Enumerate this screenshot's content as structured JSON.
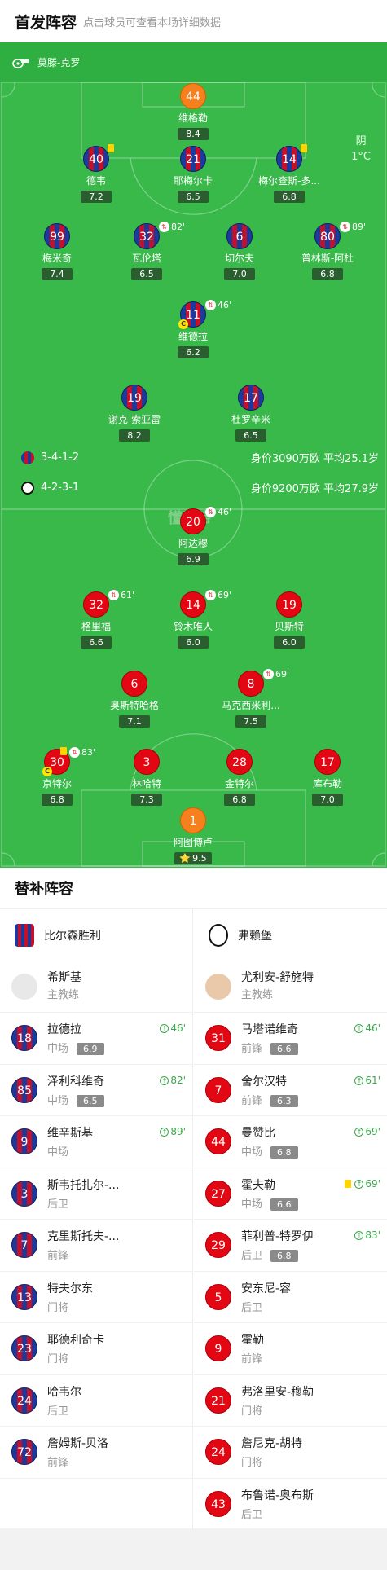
{
  "header": {
    "title": "首发阵容",
    "subtitle": "点击球员可查看本场详细数据"
  },
  "pitch": {
    "referee": "莫滕-克罗",
    "weather": {
      "condition": "阴",
      "temp": "1°C"
    },
    "watermark": "懂球帝",
    "home_formation": "3-4-1-2",
    "home_info": "身价3090万欧 平均25.1岁",
    "away_formation": "4-2-3-1",
    "away_info": "身价9200万欧 平均27.9岁",
    "colors": {
      "grass": "#38b94a",
      "home_blue": "#1d3a9a",
      "home_red": "#c4102b",
      "away_red": "#e30613",
      "gk_orange": "#f6801d"
    }
  },
  "home_players": [
    {
      "num": "44",
      "name": "维格勒",
      "rating": "8.4",
      "kind": "gk"
    },
    {
      "num": "40",
      "name": "德韦",
      "rating": "7.2",
      "kind": "home"
    },
    {
      "num": "21",
      "name": "耶梅尔卡",
      "rating": "6.5",
      "kind": "home"
    },
    {
      "num": "14",
      "name": "梅尔查斯-多...",
      "rating": "6.8",
      "kind": "home"
    },
    {
      "num": "99",
      "name": "梅米奇",
      "rating": "7.4",
      "kind": "home"
    },
    {
      "num": "32",
      "name": "瓦伦塔",
      "rating": "6.5",
      "kind": "home",
      "sub_time": "82'"
    },
    {
      "num": "6",
      "name": "切尔夫",
      "rating": "7.0",
      "kind": "home"
    },
    {
      "num": "80",
      "name": "普林斯-阿杜",
      "rating": "6.8",
      "kind": "home",
      "sub_time": "89'"
    },
    {
      "num": "11",
      "name": "维德拉",
      "rating": "6.2",
      "kind": "home",
      "sub_time": "46'"
    },
    {
      "num": "19",
      "name": "谢克-索亚雷",
      "rating": "8.2",
      "kind": "home"
    },
    {
      "num": "17",
      "name": "杜罗辛米",
      "rating": "6.5",
      "kind": "home"
    }
  ],
  "away_players": [
    {
      "num": "20",
      "name": "阿达穆",
      "rating": "6.9",
      "kind": "away",
      "sub_time": "46'"
    },
    {
      "num": "32",
      "name": "格里福",
      "rating": "6.6",
      "kind": "away",
      "sub_time": "61'"
    },
    {
      "num": "14",
      "name": "铃木唯人",
      "rating": "6.0",
      "kind": "away",
      "sub_time": "69'"
    },
    {
      "num": "19",
      "name": "贝斯特",
      "rating": "6.0",
      "kind": "away"
    },
    {
      "num": "6",
      "name": "奥斯特哈格",
      "rating": "7.1",
      "kind": "away"
    },
    {
      "num": "8",
      "name": "马克西米利...",
      "rating": "7.5",
      "kind": "away",
      "sub_time": "69'"
    },
    {
      "num": "30",
      "name": "京特尔",
      "rating": "6.8",
      "kind": "away",
      "sub_time": "83'"
    },
    {
      "num": "3",
      "name": "林哈特",
      "rating": "7.3",
      "kind": "away"
    },
    {
      "num": "28",
      "name": "金特尔",
      "rating": "6.8",
      "kind": "away"
    },
    {
      "num": "17",
      "name": "库布勒",
      "rating": "7.0",
      "kind": "away"
    },
    {
      "num": "1",
      "name": "阿图博卢",
      "rating": "9.5",
      "kind": "gk",
      "star": "⭐"
    }
  ],
  "subs": {
    "title": "替补阵容",
    "home_team": "比尔森胜利",
    "away_team": "弗赖堡",
    "home_coach": {
      "name": "希斯基",
      "role": "主教练"
    },
    "away_coach": {
      "name": "尤利安-舒施特",
      "role": "主教练"
    },
    "home": [
      {
        "num": "18",
        "name": "拉德拉",
        "pos": "中场",
        "rating": "6.9",
        "in": "46'"
      },
      {
        "num": "85",
        "name": "泽利科维奇",
        "pos": "中场",
        "rating": "6.5",
        "in": "82'"
      },
      {
        "num": "9",
        "name": "维辛斯基",
        "pos": "中场",
        "rating": "",
        "in": "89'"
      },
      {
        "num": "3",
        "name": "斯韦托扎尔-...",
        "pos": "后卫",
        "rating": "",
        "in": ""
      },
      {
        "num": "7",
        "name": "克里斯托夫-...",
        "pos": "前锋",
        "rating": "",
        "in": ""
      },
      {
        "num": "13",
        "name": "特夫尔东",
        "pos": "门将",
        "rating": "",
        "in": ""
      },
      {
        "num": "23",
        "name": "耶德利奇卡",
        "pos": "门将",
        "rating": "",
        "in": ""
      },
      {
        "num": "24",
        "name": "哈韦尔",
        "pos": "后卫",
        "rating": "",
        "in": ""
      },
      {
        "num": "72",
        "name": "詹姆斯-贝洛",
        "pos": "前锋",
        "rating": "",
        "in": ""
      }
    ],
    "away": [
      {
        "num": "31",
        "name": "马塔诺维奇",
        "pos": "前锋",
        "rating": "6.6",
        "in": "46'"
      },
      {
        "num": "7",
        "name": "舍尔汉特",
        "pos": "前锋",
        "rating": "6.3",
        "in": "61'"
      },
      {
        "num": "44",
        "name": "曼赞比",
        "pos": "中场",
        "rating": "6.8",
        "in": "69'"
      },
      {
        "num": "27",
        "name": "霍夫勒",
        "pos": "中场",
        "rating": "6.6",
        "in": "69'",
        "card": true
      },
      {
        "num": "29",
        "name": "菲利普-特罗伊",
        "pos": "后卫",
        "rating": "6.8",
        "in": "83'"
      },
      {
        "num": "5",
        "name": "安东尼-容",
        "pos": "后卫",
        "rating": "",
        "in": ""
      },
      {
        "num": "9",
        "name": "霍勒",
        "pos": "前锋",
        "rating": "",
        "in": ""
      },
      {
        "num": "21",
        "name": "弗洛里安-穆勒",
        "pos": "门将",
        "rating": "",
        "in": ""
      },
      {
        "num": "24",
        "name": "詹尼克-胡特",
        "pos": "门将",
        "rating": "",
        "in": ""
      },
      {
        "num": "43",
        "name": "布鲁诺-奥布斯",
        "pos": "后卫",
        "rating": "",
        "in": ""
      }
    ]
  }
}
